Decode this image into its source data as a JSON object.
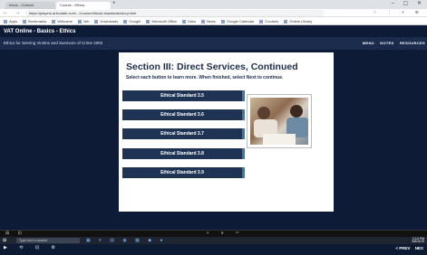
{
  "browser": {
    "tabs": [
      {
        "label": "Inbox - Outlook"
      },
      {
        "label": "Course - Ethics"
      }
    ],
    "new_tab": "+",
    "window_controls": "– ▢ ✕",
    "nav_buttons": "← → ⟳",
    "url": "https://players.articulate.com/.../course/ethical-standards/story.html",
    "extension_icons": "☆ ⋮ ◐ ⊕",
    "bookmarks": [
      "Apps",
      "Bookmarks",
      "Welcome",
      "Net",
      "Downloads",
      "Google",
      "Microsoft Office",
      "Data",
      "News",
      "Google Calendar",
      "Courses",
      "Online Library"
    ]
  },
  "course": {
    "title": "VAT Online - Basics - Ethics",
    "subtitle": "Ethics for Serving Victims and Survivors of Crime 2002",
    "menu": [
      "MENU",
      "NOTES",
      "RESOURCES"
    ],
    "slide": {
      "heading": "Section III:  Direct Services, Continued",
      "instructions": "Select each button to learn more. When finished, select Next to continue.",
      "buttons": [
        {
          "label": "Ethical Standard 3.5"
        },
        {
          "label": "Ethical Standard 3.6"
        },
        {
          "label": "Ethical Standard 3.7"
        },
        {
          "label": "Ethical Standard 3.8"
        },
        {
          "label": "Ethical Standard 3.9"
        }
      ]
    },
    "player": {
      "controls": "▶ ⟲ ⊡ ⚙",
      "prev": "< PREV",
      "next": "NEX"
    }
  },
  "vm_bar": {
    "left": "⊞ ⊟",
    "center": "⏸ ⏹ ▭"
  },
  "taskbar": {
    "start": "⊞",
    "search_placeholder": "Type here to search",
    "apps": "▣ e ▤ ◉ ▦ ◆ ●",
    "clock_time": "2:10 PM",
    "clock_date": "5/8/2019"
  },
  "colors": {
    "slide_button": "#1f3354",
    "slide_button_accent": "#3d7b9e",
    "course_bg": "#0d1b36"
  }
}
